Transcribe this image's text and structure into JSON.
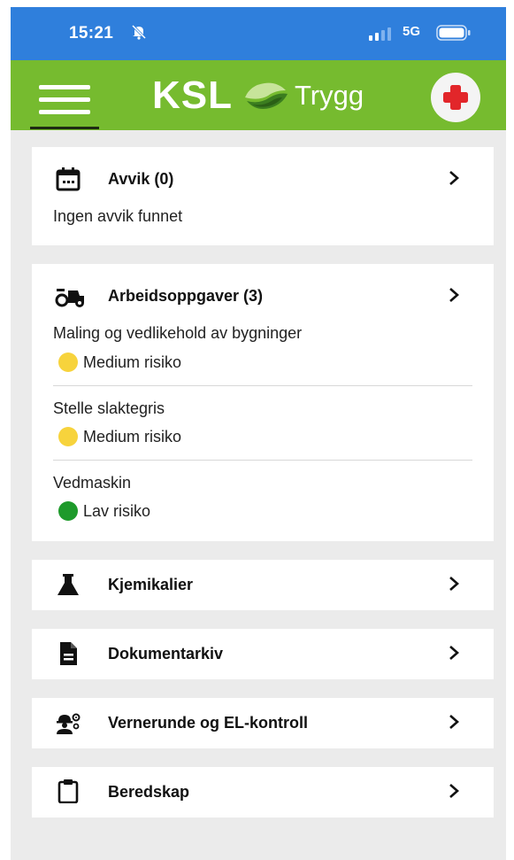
{
  "status_bar": {
    "time": "15:21",
    "network": "5G"
  },
  "app_bar": {
    "logo_ksl": "KSL",
    "logo_trygg": "Trygg",
    "brand_color": "#76bb2f",
    "emergency_icon": "red-cross-icon"
  },
  "cards": {
    "avvik": {
      "title": "Avvik (0)",
      "icon": "calendar-icon",
      "empty_text": "Ingen avvik funnet"
    },
    "arbeidsoppgaver": {
      "title": "Arbeidsoppgaver (3)",
      "icon": "tractor-icon",
      "tasks": [
        {
          "name": "Maling og vedlikehold av bygninger",
          "risk": "Medium risiko",
          "risk_color": "#f7d33c"
        },
        {
          "name": "Stelle slaktegris",
          "risk": "Medium risiko",
          "risk_color": "#f7d33c"
        },
        {
          "name": "Vedmaskin",
          "risk": "Lav risiko",
          "risk_color": "#1e9a2b"
        }
      ]
    },
    "kjemikalier": {
      "title": "Kjemikalier",
      "icon": "flask-icon"
    },
    "dokumentarkiv": {
      "title": "Dokumentarkiv",
      "icon": "document-icon"
    },
    "vernerunde": {
      "title": "Vernerunde og EL-kontroll",
      "icon": "worker-gear-icon"
    },
    "beredskap": {
      "title": "Beredskap",
      "icon": "clipboard-icon"
    }
  }
}
